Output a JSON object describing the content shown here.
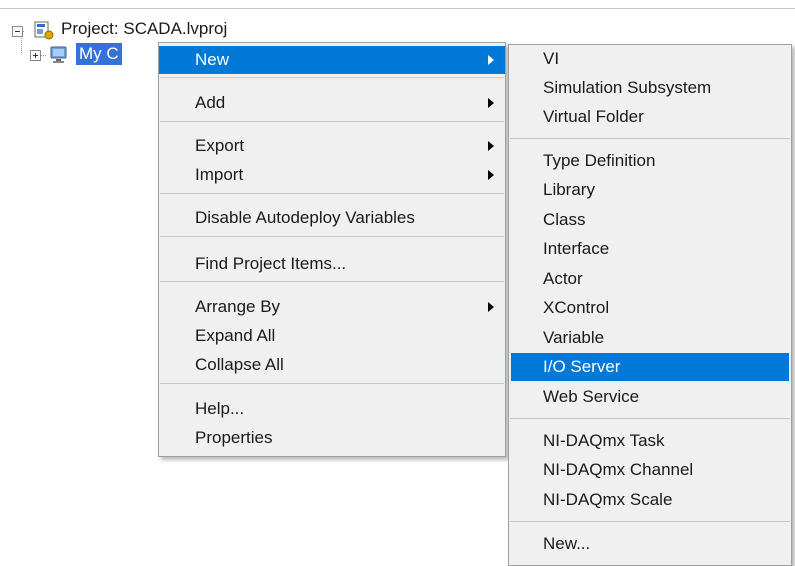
{
  "tree": {
    "project_label": "Project: SCADA.lvproj",
    "computer_label": "My C"
  },
  "context_menu": {
    "items": [
      {
        "label": "New"
      },
      {
        "label": "Add"
      },
      {
        "label": "Export"
      },
      {
        "label": "Import"
      },
      {
        "label": "Disable Autodeploy Variables"
      },
      {
        "label": "Find Project Items..."
      },
      {
        "label": "Arrange By"
      },
      {
        "label": "Expand All"
      },
      {
        "label": "Collapse All"
      },
      {
        "label": "Help..."
      },
      {
        "label": "Properties"
      }
    ]
  },
  "submenu_new": {
    "items": [
      {
        "label": "VI"
      },
      {
        "label": "Simulation Subsystem"
      },
      {
        "label": "Virtual Folder"
      },
      {
        "label": "Type Definition"
      },
      {
        "label": "Library"
      },
      {
        "label": "Class"
      },
      {
        "label": "Interface"
      },
      {
        "label": "Actor"
      },
      {
        "label": "XControl"
      },
      {
        "label": "Variable"
      },
      {
        "label": "I/O Server"
      },
      {
        "label": "Web Service"
      },
      {
        "label": "NI-DAQmx Task"
      },
      {
        "label": "NI-DAQmx Channel"
      },
      {
        "label": "NI-DAQmx Scale"
      },
      {
        "label": "New..."
      }
    ]
  },
  "colors": {
    "highlight": "#0078d7",
    "menu_background": "#f0f0f0",
    "tree_selection": "#3373d9"
  },
  "icons": {
    "project": "project-icon",
    "computer": "computer-icon",
    "expand_collapse": "expander-icon",
    "submenu_arrow": "submenu-arrow-icon"
  }
}
